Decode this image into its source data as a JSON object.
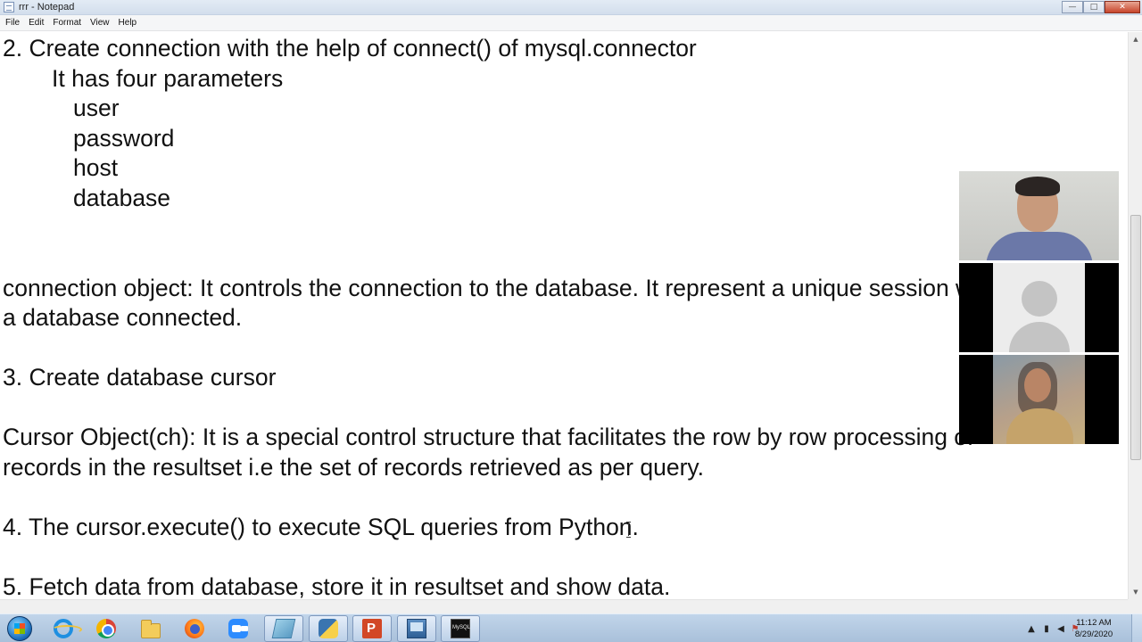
{
  "window": {
    "title": "rrr - Notepad",
    "controls": {
      "minimize": "—",
      "maximize": "□",
      "close": "✕"
    }
  },
  "menu": [
    "File",
    "Edit",
    "Format",
    "View",
    "Help"
  ],
  "document": {
    "lines": [
      "2. Create connection with the help of connect() of mysql.connector",
      "It has four parameters",
      "user",
      "password",
      "host",
      "database",
      "connection object: It controls the connection to the database. It represent a unique session with",
      "a database connected.",
      "3. Create database cursor",
      "Cursor Object(ch): It is a special control structure that facilitates the row by row processing of",
      "records in the resultset i.e the set of records retrieved as per query.",
      "4. The cursor.execute() to execute SQL queries from Python.",
      "5. Fetch data from database, store it in resultset and show data."
    ]
  },
  "scrollbar": {
    "up": "▲",
    "down": "▼"
  },
  "video_call": {
    "participants": [
      "presenter-camera",
      "participant-avatar",
      "participant-camera"
    ]
  },
  "taskbar": {
    "apps": [
      "windows-start",
      "internet-explorer",
      "chrome",
      "file-explorer",
      "firefox",
      "zoom",
      "notepad-app",
      "python",
      "powerpoint",
      "screen-app",
      "mysql"
    ],
    "tray": {
      "arrow": "▲",
      "network": "▮",
      "volume": "◀",
      "flag": "⚑"
    },
    "clock": {
      "time": "11:12 AM",
      "date": "8/29/2020"
    }
  }
}
